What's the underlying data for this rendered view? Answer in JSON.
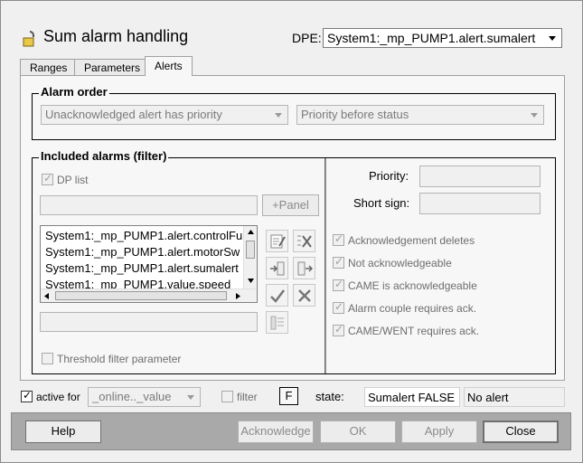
{
  "header": {
    "title": "Sum alarm handling",
    "dpe_label": "DPE:",
    "dpe_value": "System1:_mp_PUMP1.alert.sumalert"
  },
  "tabs": [
    {
      "label": "Ranges",
      "active": false
    },
    {
      "label": "Parameters",
      "active": false
    },
    {
      "label": "Alerts",
      "active": true
    }
  ],
  "alarm_order": {
    "title": "Alarm order",
    "combo1": "Unacknowledged alert has priority",
    "combo2": "Priority before status"
  },
  "included": {
    "title": "Included alarms (filter)",
    "dp_list_label": "DP list",
    "dp_list_checked": true,
    "panel_button": "+Panel",
    "list_items": [
      "System1:_mp_PUMP1.alert.controlFu",
      "System1:_mp_PUMP1.alert.motorSw",
      "System1:_mp_PUMP1.alert.sumalert",
      "System1:_mp_PUMP1.value.speed"
    ],
    "threshold_label": "Threshold filter parameter",
    "priority_label": "Priority:",
    "short_sign_label": "Short sign:",
    "options": [
      {
        "label": "Acknowledgement deletes",
        "checked": true
      },
      {
        "label": "Not acknowledgeable",
        "checked": true
      },
      {
        "label": "CAME is acknowledgeable",
        "checked": true
      },
      {
        "label": "Alarm couple requires ack.",
        "checked": true
      },
      {
        "label": "CAME/WENT requires ack.",
        "checked": true
      }
    ]
  },
  "footer": {
    "active_for_label": "active for",
    "active_for_checked": true,
    "active_for_value": "_online.._value",
    "filter_label": "filter",
    "f_button": "F",
    "state_label": "state:",
    "state_value": "Sumalert FALSE",
    "alert_value": "No alert"
  },
  "buttons": {
    "help": "Help",
    "acknowledge": "Acknowledge",
    "ok": "OK",
    "apply": "Apply",
    "close": "Close"
  }
}
